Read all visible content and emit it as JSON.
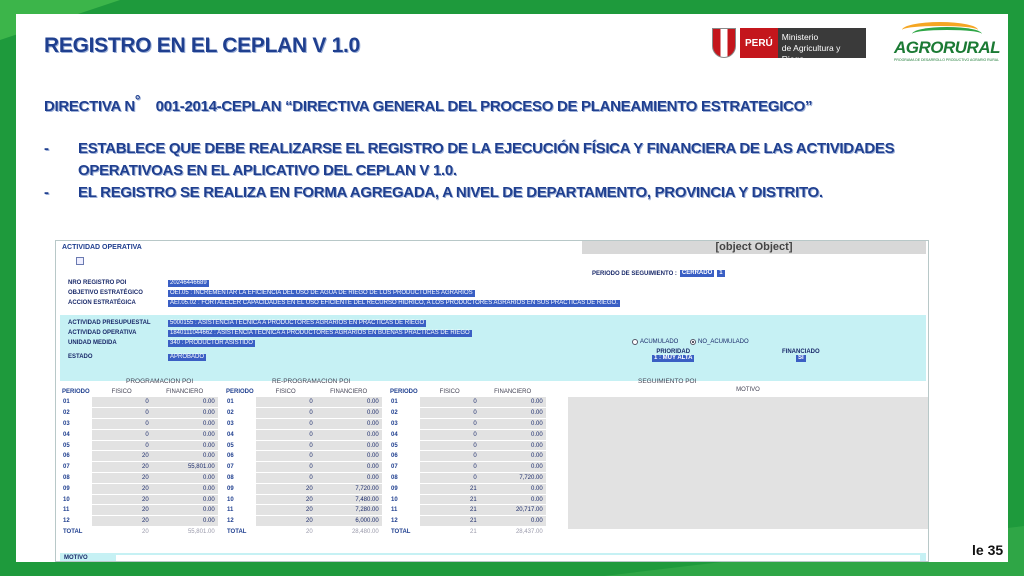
{
  "title": "REGISTRO EN EL CEPLAN V 1.0",
  "logos": {
    "peru": "PERÚ",
    "ministerio_line1": "Ministerio",
    "ministerio_line2": "de Agricultura y Riego",
    "agrorural": "AGRORURAL",
    "agrorural_sub": "PROGRAMA DE DESARROLLO PRODUCTIVO AGRARIO RURAL"
  },
  "directiva": {
    "prefix": "DIRECTIVA N",
    "sup": "°",
    "text": "001-2014-CEPLAN “DIRECTIVA GENERAL DEL PROCESO DE PLANEAMIENTO ESTRATEGICO”"
  },
  "bullets": [
    {
      "dash": "-",
      "text": "ESTABLECE QUE DEBE REALIZARSE EL REGISTRO DE LA EJECUCIÓN FÍSICA Y FINANCIERA DE LAS ACTIVIDADES OPERATIVOAS EN EL APLICATIVO DEL CEPLAN V 1.0."
    },
    {
      "dash": "-",
      "text": "EL REGISTRO SE REALIZA  EN FORMA AGREGADA, A NIVEL DE DEPARTAMENTO, PROVINCIA Y DISTRITO."
    }
  ],
  "shot": {
    "actividad_operativa": "ACTIVIDAD OPERATIVA",
    "seguimiento": {
      "rows": [
        [
          "01",
          "0",
          "0.00"
        ],
        [
          "02",
          "0",
          "0.00"
        ],
        [
          "03",
          "0",
          "0.00"
        ],
        [
          "04",
          "0",
          "0.00"
        ],
        [
          "05",
          "0",
          "0.00"
        ],
        [
          "06",
          "0",
          "0.00"
        ],
        [
          "07",
          "0",
          "0.00"
        ],
        [
          "08",
          "0",
          "7,720.00"
        ],
        [
          "09",
          "21",
          "0.00"
        ],
        [
          "10",
          "21",
          "0.00"
        ],
        [
          "11",
          "21",
          "20,717.00"
        ],
        [
          "12",
          "21",
          "0.00"
        ]
      ],
      "total": [
        "21",
        "28,437.00"
      ]
    },
    "periodo_seg_label": "PERIODO DE SEGUIMIENTO :",
    "periodo_seg_value": "CERRADO",
    "periodo_seg_num": "1",
    "fields_top": [
      {
        "label": "NRO REGISTRO POI",
        "value": "20246446689"
      },
      {
        "label": "OBJETIVO ESTRATÉGICO",
        "value": "OEI.05 : INCREMENTAR LA EFICIENCIA DEL USO DE AGUA DE RIEGO DE LOS PRODUCTORES AGRARIOS"
      },
      {
        "label": "ACCION ESTRATÉGICA",
        "value": "AEI.05.02 : FORTALECER CAPACIDADES EN EL USO EFICIENTE DEL RECURSO HIDRICO, A LOS PRODUCTORES AGRARIOS EN SUS PRACTICAS DE RIEGO."
      }
    ],
    "fields_band": [
      {
        "label": "ACTIVIDAD PRESUPUESTAL",
        "value": "5000155 : ASISTENCIA TECNICA A PRODUCTORES AGRARIOS EN PRACTICAS DE RIEGO"
      },
      {
        "label": "ACTIVIDAD OPERATIVA",
        "value": "1840111044662 : ASISTENCIA TECNICA A PRODUCTORES AGRARIOS EN BUENAS PRACTICAS DE RIEGO"
      },
      {
        "label": "UNIDAD MEDIDA",
        "value": "340 : PRODUCTOR ASISTIDO"
      },
      {
        "label": "ESTADO",
        "value": "APROBADO"
      }
    ],
    "radio_acumulado": "ACUMULADO",
    "radio_no_acumulado": "NO_ACUMULADO",
    "prioridad_label": "PRIORIDAD",
    "prioridad_value": "1 : MUY ALTA",
    "financiado_label": "FINANCIADO",
    "financiado_value": "SI",
    "sections": [
      "PROGRAMACION POI",
      "RE-PROGRAMACION POI",
      "SEGUIMIENTO POI"
    ],
    "col_headers": [
      "PERIODO",
      "FISICO",
      "FINANCIERO"
    ],
    "motivo_header": "MOTIVO",
    "motivo_label": "MOTIVO",
    "total_label": "TOTAL",
    "programacion": {
      "rows": [
        [
          "01",
          "0",
          "0.00"
        ],
        [
          "02",
          "0",
          "0.00"
        ],
        [
          "03",
          "0",
          "0.00"
        ],
        [
          "04",
          "0",
          "0.00"
        ],
        [
          "05",
          "0",
          "0.00"
        ],
        [
          "06",
          "20",
          "0.00"
        ],
        [
          "07",
          "20",
          "55,801.00"
        ],
        [
          "08",
          "20",
          "0.00"
        ],
        [
          "09",
          "20",
          "0.00"
        ],
        [
          "10",
          "20",
          "0.00"
        ],
        [
          "11",
          "20",
          "0.00"
        ],
        [
          "12",
          "20",
          "0.00"
        ]
      ],
      "total": [
        "20",
        "55,801.00"
      ]
    },
    "reprogramacion": {
      "rows": [
        [
          "01",
          "0",
          "0.00"
        ],
        [
          "02",
          "0",
          "0.00"
        ],
        [
          "03",
          "0",
          "0.00"
        ],
        [
          "04",
          "0",
          "0.00"
        ],
        [
          "05",
          "0",
          "0.00"
        ],
        [
          "06",
          "0",
          "0.00"
        ],
        [
          "07",
          "0",
          "0.00"
        ],
        [
          "08",
          "0",
          "0.00"
        ],
        [
          "09",
          "20",
          "7,720.00"
        ],
        [
          "10",
          "20",
          "7,480.00"
        ],
        [
          "11",
          "20",
          "7,280.00"
        ],
        [
          "12",
          "20",
          "6,000.00"
        ]
      ],
      "total": [
        "20",
        "28,480.00"
      ]
    }
  },
  "page_number": "le 35"
}
